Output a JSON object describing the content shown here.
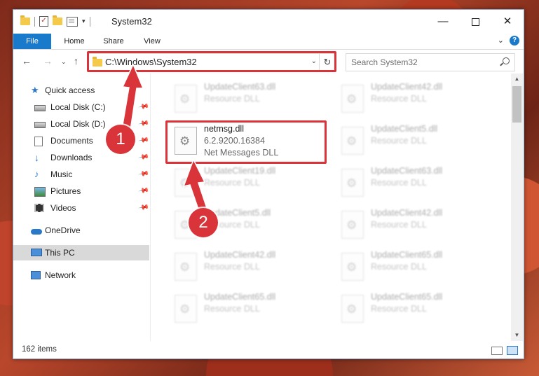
{
  "window": {
    "title": "System32"
  },
  "ribbon": {
    "tabs": [
      "File",
      "Home",
      "Share",
      "View"
    ]
  },
  "address": {
    "path": "C:\\Windows\\System32"
  },
  "search": {
    "placeholder": "Search System32"
  },
  "sidebar": {
    "items": [
      {
        "label": "Quick access",
        "icon": "star-icon"
      },
      {
        "label": "Local Disk (C:)",
        "icon": "disk-icon",
        "pinned": true
      },
      {
        "label": "Local Disk (D:)",
        "icon": "disk-icon",
        "pinned": true
      },
      {
        "label": "Documents",
        "icon": "documents-icon",
        "pinned": true
      },
      {
        "label": "Downloads",
        "icon": "download-icon",
        "pinned": true
      },
      {
        "label": "Music",
        "icon": "music-icon",
        "pinned": true
      },
      {
        "label": "Pictures",
        "icon": "pictures-icon",
        "pinned": true
      },
      {
        "label": "Videos",
        "icon": "videos-icon",
        "pinned": true
      },
      {
        "label": "OneDrive",
        "icon": "cloud-icon"
      },
      {
        "label": "This PC",
        "icon": "computer-icon",
        "selected": true
      },
      {
        "label": "Network",
        "icon": "network-icon"
      }
    ]
  },
  "files": {
    "highlighted": {
      "name": "netmsg.dll",
      "version": "6.2.9200.16384",
      "description": "Net Messages DLL"
    },
    "left_column": [
      {
        "name": "UpdateClient63.dll",
        "description": "Resource DLL"
      },
      {
        "name": "UpdateClient19.dll",
        "description": "Resource DLL"
      },
      {
        "name": "UpdateClient5.dll",
        "description": "Resource DLL"
      },
      {
        "name": "UpdateClient42.dll",
        "description": "Resource DLL"
      },
      {
        "name": "UpdateClient65.dll",
        "description": "Resource DLL"
      }
    ],
    "right_column": [
      {
        "name": "UpdateClient42.dll",
        "description": "Resource DLL"
      },
      {
        "name": "UpdateClient5.dll",
        "description": "Resource DLL"
      },
      {
        "name": "UpdateClient63.dll",
        "description": "Resource DLL"
      },
      {
        "name": "UpdateClient42.dll",
        "description": "Resource DLL"
      },
      {
        "name": "UpdateClient65.dll",
        "description": "Resource DLL"
      },
      {
        "name": "UpdateClient65.dll",
        "description": "Resource DLL"
      }
    ]
  },
  "status": {
    "item_count": "162 items"
  },
  "annotations": {
    "step1": "1",
    "step2": "2",
    "color": "#d9343a"
  }
}
